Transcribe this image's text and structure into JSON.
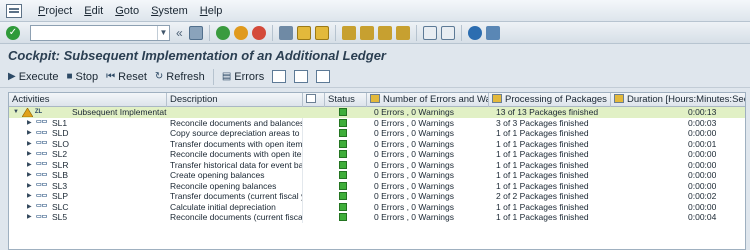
{
  "menu": [
    "Project",
    "Edit",
    "Goto",
    "System",
    "Help"
  ],
  "menu_underline": [
    "P",
    "E",
    "G",
    "S",
    "H"
  ],
  "system_toolbar": {
    "command_field_value": "",
    "icons": [
      "save-icon",
      "back-icon",
      "exit-icon",
      "cancel-icon",
      "print-icon",
      "find-icon",
      "find-next-icon",
      "first-page-icon",
      "prev-page-icon",
      "next-page-icon",
      "last-page-icon",
      "new-session-icon",
      "shortcut-icon",
      "help-icon",
      "customize-icon"
    ]
  },
  "title": "Cockpit: Subsequent Implementation of an Additional Ledger",
  "app_toolbar": {
    "execute": "Execute",
    "stop": "Stop",
    "reset": "Reset",
    "refresh": "Refresh",
    "errors": "Errors"
  },
  "columns": {
    "activities": "Activities",
    "description": "Description",
    "status": "Status",
    "errors": "Number of Errors and Warnings",
    "packages": "Processing of Packages",
    "duration": "Duration [Hours:Minutes:Sec..."
  },
  "root": {
    "id": "ZL",
    "label": "Subsequent Implementation",
    "errors": "0 Errors , 0 Warnings",
    "packages": "13 of 13 Packages finished",
    "duration": "0:00:13"
  },
  "rows": [
    {
      "id": "SL1",
      "description": "Reconcile documents and balances be...",
      "errors": "0 Errors , 0 Warnings",
      "packages": "3 of 3 Packages finished",
      "duration": "0:00:03"
    },
    {
      "id": "SLD",
      "description": "Copy source depreciation areas to ass...",
      "errors": "0 Errors , 0 Warnings",
      "packages": "1 of 1 Packages finished",
      "duration": "0:00:00"
    },
    {
      "id": "SLO",
      "description": "Transfer documents with open items ...",
      "errors": "0 Errors , 0 Warnings",
      "packages": "1 of 1 Packages finished",
      "duration": "0:00:01"
    },
    {
      "id": "SL2",
      "description": "Reconcile documents with open items...",
      "errors": "0 Errors , 0 Warnings",
      "packages": "1 of 1 Packages finished",
      "duration": "0:00:00"
    },
    {
      "id": "SLR",
      "description": "Transfer historical data for event base...",
      "errors": "0 Errors , 0 Warnings",
      "packages": "1 of 1 Packages finished",
      "duration": "0:00:00"
    },
    {
      "id": "SLB",
      "description": "Create opening balances",
      "errors": "0 Errors , 0 Warnings",
      "packages": "1 of 1 Packages finished",
      "duration": "0:00:00"
    },
    {
      "id": "SL3",
      "description": "Reconcile opening balances",
      "errors": "0 Errors , 0 Warnings",
      "packages": "1 of 1 Packages finished",
      "duration": "0:00:00"
    },
    {
      "id": "SLP",
      "description": "Transfer documents (current fiscal year)",
      "errors": "0 Errors , 0 Warnings",
      "packages": "2 of 2 Packages finished",
      "duration": "0:00:02"
    },
    {
      "id": "SLC",
      "description": "Calculate initial depreciation",
      "errors": "0 Errors , 0 Warnings",
      "packages": "1 of 1 Packages finished",
      "duration": "0:00:00"
    },
    {
      "id": "SL5",
      "description": "Reconcile documents (current fiscal y...",
      "errors": "0 Errors , 0 Warnings",
      "packages": "1 of 1 Packages finished",
      "duration": "0:00:04"
    }
  ],
  "colors": {
    "status_ok": "#3fae3a",
    "root_highlight": "#e1f0c5",
    "warning": "#e0a21a"
  }
}
